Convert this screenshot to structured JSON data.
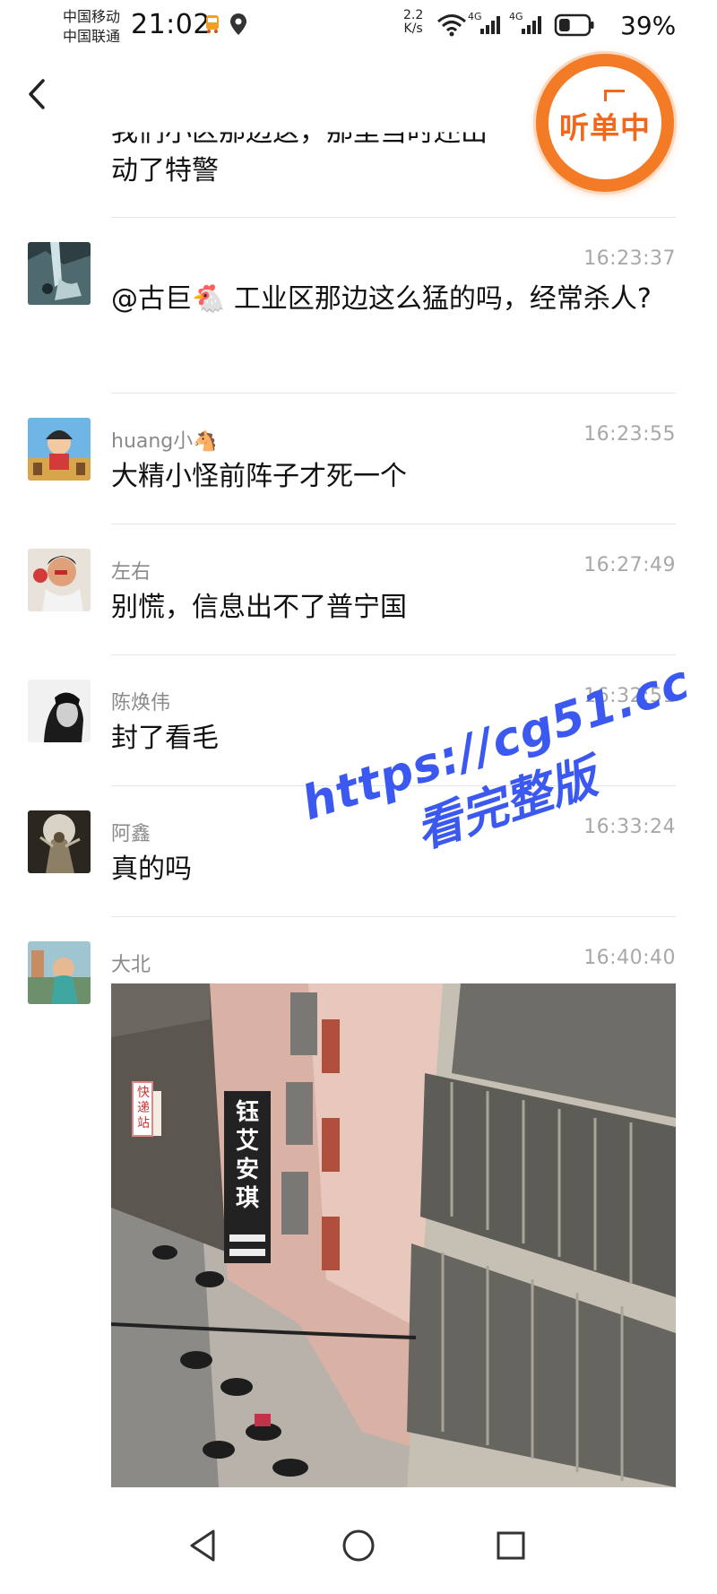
{
  "status_bar": {
    "carrier_1": "中国移动",
    "carrier_2": "中国联通",
    "time": "21:02",
    "speed_value": "2.2",
    "speed_unit": "K/s",
    "network_1": "4G",
    "network_2": "4G",
    "battery": "39%",
    "battery_level": 0.39,
    "icons": [
      "bus-icon",
      "location-icon",
      "wifi-icon",
      "signal-icon",
      "signal-icon",
      "battery-icon"
    ]
  },
  "header": {
    "back_icon": "chevron-left-icon",
    "listen_label": "听单中",
    "accent_color": "#f47b25"
  },
  "top_message": {
    "line1": "我们小区那边这，那里当时还出",
    "line2": "动了特警"
  },
  "comments": [
    {
      "username": "",
      "time": "16:23:37",
      "text": "@古巨🐔 工业区那边这么猛的吗，经常杀人?"
    },
    {
      "username": "huang小🐴",
      "time": "16:23:55",
      "text": "大精小怪前阵子才死一个"
    },
    {
      "username": "左右",
      "time": "16:27:49",
      "text": "别慌，信息出不了普宁国"
    },
    {
      "username": "陈焕伟",
      "time": "16:32:51",
      "text": "封了看毛"
    },
    {
      "username": "阿鑫",
      "time": "16:33:24",
      "text": "真的吗"
    },
    {
      "username": "大北",
      "time": "16:40:40",
      "text": ""
    }
  ],
  "photo": {
    "sign_text": "钰 艾 安 琪",
    "sign_small": "快递站"
  },
  "watermark": {
    "line1": "https://cg51.cc",
    "line2": "看完整版"
  },
  "nav": {
    "back": "triangle-back-icon",
    "home": "circle-home-icon",
    "recents": "square-recents-icon"
  }
}
